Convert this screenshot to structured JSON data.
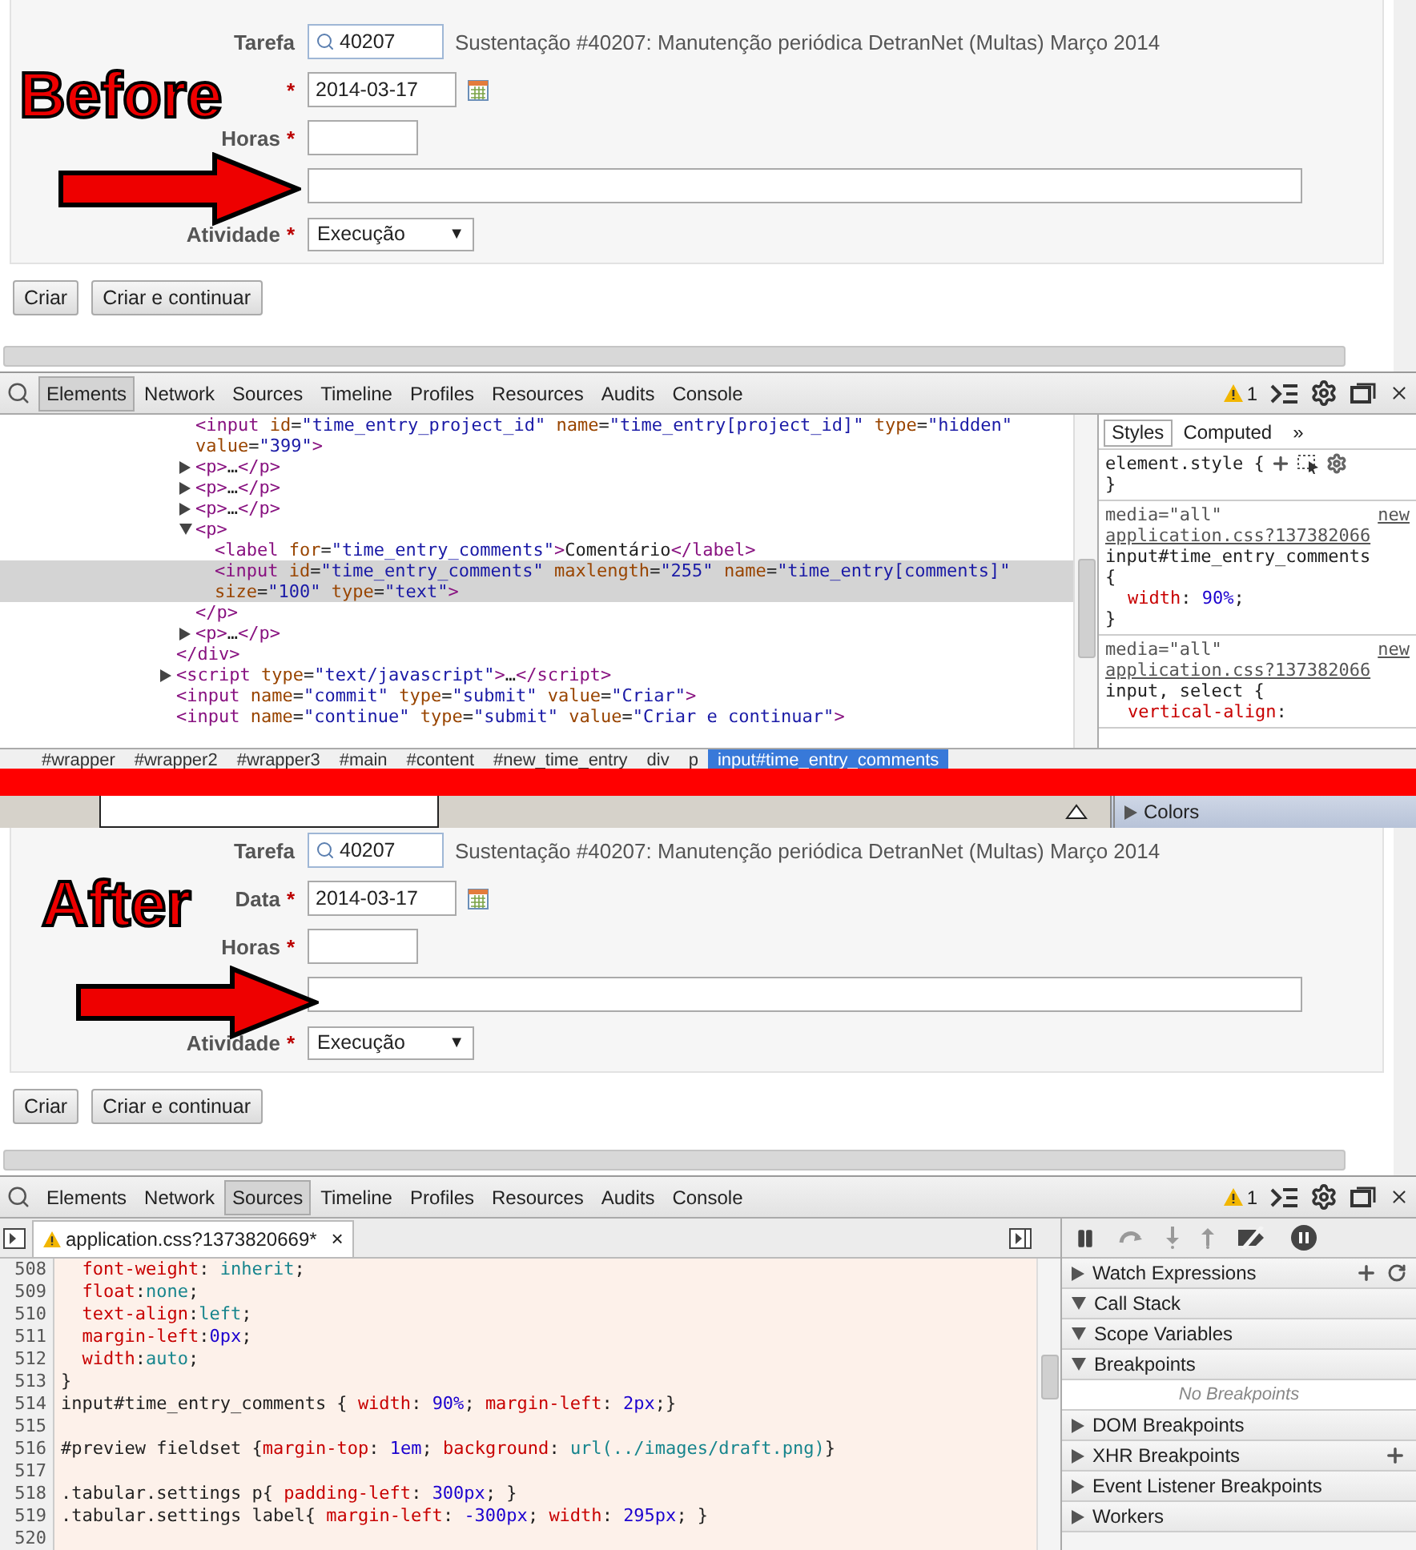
{
  "before": {
    "caption": "Before",
    "form": {
      "fields": [
        {
          "kind": "task",
          "label": "Tarefa",
          "value": "40207",
          "description": "Sustentação #40207: Manutenção periódica DetranNet (Multas) Março 2014"
        },
        {
          "kind": "date",
          "required_mark": "*",
          "value": "2014-03-17"
        },
        {
          "kind": "short",
          "label": "Horas",
          "required_mark": "*"
        },
        {
          "kind": "wide"
        },
        {
          "kind": "select",
          "label": "Atividade",
          "required_mark": "*",
          "value": "Execução",
          "caret": "▼"
        }
      ],
      "buttons": [
        "Criar",
        "Criar e continuar"
      ]
    },
    "devtools": {
      "tabs": [
        {
          "label": "Elements",
          "selected": true
        },
        {
          "label": "Network",
          "selected": false
        },
        {
          "label": "Sources",
          "selected": false
        },
        {
          "label": "Timeline",
          "selected": false
        },
        {
          "label": "Profiles",
          "selected": false
        },
        {
          "label": "Resources",
          "selected": false
        },
        {
          "label": "Audits",
          "selected": false
        },
        {
          "label": "Console",
          "selected": false
        }
      ],
      "warnings": "1",
      "tree": [
        {
          "closing": "</div>",
          "children": [
            {
              "text": "<input id=\"time_entry_project_id\" name=\"time_entry[project_id]\" type=\"hidden\" value=\"399\">"
            },
            {
              "text": "<p>…</p>",
              "expanded": false,
              "selected": false
            },
            {
              "text": "<p>…</p>",
              "expanded": false,
              "selected": false
            },
            {
              "text": "<p>…</p>",
              "expanded": false,
              "selected": false
            },
            {
              "text": "<p>",
              "expanded": true,
              "closing": "</p>",
              "children": [
                {
                  "text": "<label for=\"time_entry_comments\">Comentário</label>",
                  "selected": false
                },
                {
                  "text": "<input id=\"time_entry_comments\" maxlength=\"255\" name=\"time_entry[comments]\" size=\"100\" type=\"text\">",
                  "selected": true
                }
              ]
            },
            {
              "text": "<p>…</p>",
              "expanded": false,
              "selected": false
            }
          ]
        },
        {
          "text": "<script type=\"text/javascript\">…</script>",
          "expanded": false,
          "selected": false
        },
        {
          "text": "<input name=\"commit\" type=\"submit\" value=\"Criar\">",
          "selected": false
        },
        {
          "text": "<input name=\"continue\" type=\"submit\" value=\"Criar e continuar\">",
          "selected": false
        }
      ],
      "styles_tabs": [
        {
          "label": "Styles",
          "selected": true
        },
        {
          "label": "Computed",
          "selected": false
        }
      ],
      "styles_more": "»",
      "rules": [
        {
          "tools": true,
          "lines": [
            {
              "kind": "selector",
              "text": "element.style {"
            },
            {
              "kind": "brace",
              "text": "}"
            }
          ]
        },
        {
          "media": "media=\"all\"",
          "source": "new",
          "file": "application.css?137382066",
          "lines": [
            {
              "kind": "selector",
              "text": "input#time_entry_comments"
            },
            {
              "kind": "brace",
              "text": "{"
            },
            {
              "kind": "prop",
              "text": "width: 90%;"
            },
            {
              "kind": "brace",
              "text": "}"
            }
          ]
        },
        {
          "media": "media=\"all\"",
          "source": "new",
          "file": "application.css?137382066",
          "lines": [
            {
              "kind": "selector",
              "text": "input, select {"
            },
            {
              "kind": "prop",
              "text": "vertical-align:"
            }
          ]
        }
      ],
      "breadcrumbs": [
        {
          "label": "#wrapper",
          "selected": false
        },
        {
          "label": "#wrapper2",
          "selected": false
        },
        {
          "label": "#wrapper3",
          "selected": false
        },
        {
          "label": "#main",
          "selected": false
        },
        {
          "label": "#content",
          "selected": false
        },
        {
          "label": "#new_time_entry",
          "selected": false
        },
        {
          "label": "div",
          "selected": false
        },
        {
          "label": "p",
          "selected": false
        },
        {
          "label": "input#time_entry_comments",
          "selected": true
        }
      ]
    }
  },
  "strip": {
    "section": {
      "label": "Colors",
      "expanded": false
    }
  },
  "after": {
    "caption": "After",
    "form": {
      "fields": [
        {
          "kind": "task",
          "label": "Tarefa",
          "value": "40207",
          "description": "Sustentação #40207: Manutenção periódica DetranNet (Multas) Março 2014"
        },
        {
          "kind": "date",
          "label": "Data",
          "required_mark": "*",
          "value": "2014-03-17"
        },
        {
          "kind": "short",
          "label": "Horas",
          "required_mark": "*"
        },
        {
          "kind": "wide"
        },
        {
          "kind": "select",
          "label": "Atividade",
          "required_mark": "*",
          "value": "Execução",
          "caret": "▼"
        }
      ],
      "buttons": [
        "Criar",
        "Criar e continuar"
      ]
    },
    "devtools": {
      "tabs": [
        {
          "label": "Elements",
          "selected": false
        },
        {
          "label": "Network",
          "selected": false
        },
        {
          "label": "Sources",
          "selected": true
        },
        {
          "label": "Timeline",
          "selected": false
        },
        {
          "label": "Profiles",
          "selected": false
        },
        {
          "label": "Resources",
          "selected": false
        },
        {
          "label": "Audits",
          "selected": false
        },
        {
          "label": "Console",
          "selected": false
        }
      ],
      "warnings": "1",
      "file_tab": {
        "label": "application.css?1373820669*",
        "close": "×"
      },
      "code": [
        {
          "number": "508",
          "text": "  font-weight: inherit;"
        },
        {
          "number": "509",
          "text": "  float:none;"
        },
        {
          "number": "510",
          "text": "  text-align:left;"
        },
        {
          "number": "511",
          "text": "  margin-left:0px;"
        },
        {
          "number": "512",
          "text": "  width:auto;"
        },
        {
          "number": "513",
          "text": "}"
        },
        {
          "number": "514",
          "text": "input#time_entry_comments { width: 90%; margin-left: 2px;}"
        },
        {
          "number": "515"
        },
        {
          "number": "516",
          "text": "#preview fieldset {margin-top: 1em; background: url(../images/draft.png)}"
        },
        {
          "number": "517"
        },
        {
          "number": "518",
          "text": ".tabular.settings p{ padding-left: 300px; }"
        },
        {
          "number": "519",
          "text": ".tabular.settings label{ margin-left: -300px; width: 295px; }"
        },
        {
          "number": "520"
        }
      ],
      "sections": [
        {
          "label": "Watch Expressions",
          "expanded": false,
          "can_add": true,
          "can_refresh": true
        },
        {
          "label": "Call Stack",
          "expanded": true
        },
        {
          "label": "Scope Variables",
          "expanded": true
        },
        {
          "label": "Breakpoints",
          "expanded": true,
          "empty_text": "No Breakpoints"
        },
        {
          "label": "DOM Breakpoints",
          "expanded": false
        },
        {
          "label": "XHR Breakpoints",
          "expanded": false,
          "can_add": true
        },
        {
          "label": "Event Listener Breakpoints",
          "expanded": false
        },
        {
          "label": "Workers",
          "expanded": false
        }
      ]
    }
  }
}
